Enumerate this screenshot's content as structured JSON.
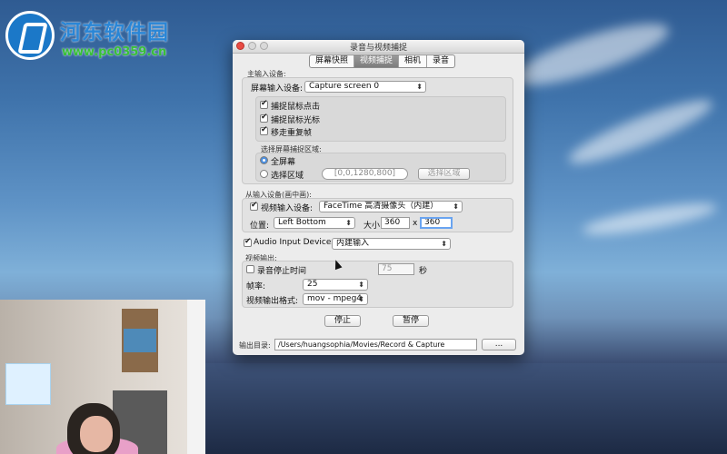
{
  "watermark": {
    "name": "河东软件园",
    "url": "www.pc0359.cn"
  },
  "window": {
    "title": "录音与视频捕捉",
    "tabs": [
      {
        "label": "屏幕快照",
        "selected": false
      },
      {
        "label": "视频捕捉",
        "selected": true
      },
      {
        "label": "相机",
        "selected": false
      },
      {
        "label": "录音",
        "selected": false
      }
    ],
    "main_input": {
      "section_label": "主输入设备:",
      "device_label": "屏幕输入设备:",
      "device_value": "Capture screen 0",
      "options": [
        {
          "label": "捕捉鼠标点击",
          "checked": true
        },
        {
          "label": "捕捉鼠标光标",
          "checked": true
        },
        {
          "label": "移走重复帧",
          "checked": true
        }
      ],
      "area": {
        "section_label": "选择屏幕捕捉区域:",
        "fullscreen_label": "全屏幕",
        "fullscreen_selected": true,
        "select_area_label": "选择区域",
        "select_area_selected": false,
        "area_value": "[0,0,1280,800]",
        "select_area_button": "选择区域"
      }
    },
    "secondary_input": {
      "section_label": "从输入设备(画中画):",
      "video_device_label": "视频输入设备:",
      "video_device_checked": true,
      "video_device_value": "FaceTime 高清摄像头（内建）",
      "position_label": "位置:",
      "position_value": "Left Bottom",
      "size_label": "大小:",
      "width_value": "360",
      "times_sign": "x",
      "height_value": "360"
    },
    "audio": {
      "label": "Audio Input Devices:",
      "checked": true,
      "value": "内建输入"
    },
    "video_output": {
      "section_label": "视频输出:",
      "stop_label": "录音停止时间",
      "stop_checked": false,
      "stop_value": "75",
      "stop_unit": "秒",
      "fps_label": "帧率:",
      "fps_value": "25",
      "format_label": "视频输出格式:",
      "format_value": "mov - mpeg4"
    },
    "buttons": {
      "stop": "停止",
      "pause": "暂停"
    },
    "output": {
      "label": "输出目录:",
      "path": "/Users/huangsophia/Movies/Record & Capture",
      "browse_label": "..."
    }
  }
}
